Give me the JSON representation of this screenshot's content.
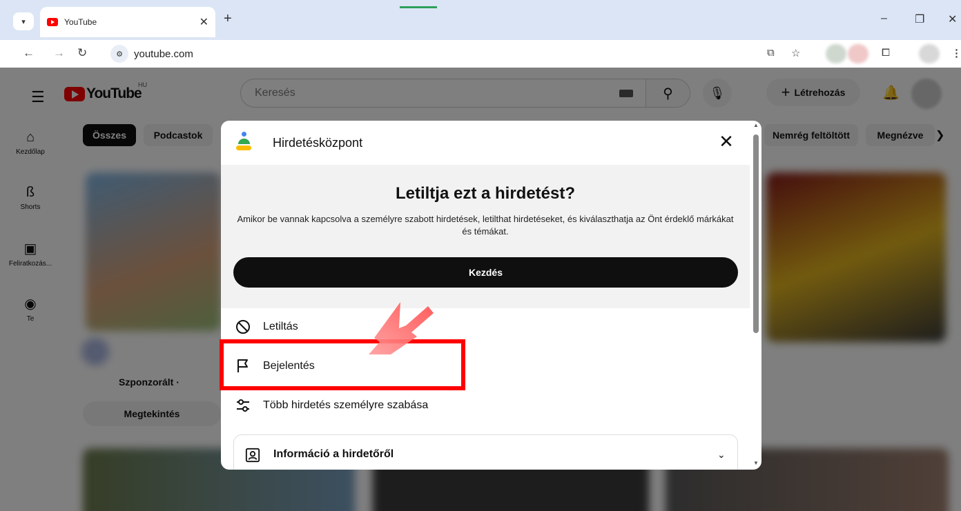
{
  "browser": {
    "tab_title": "YouTube",
    "url": "youtube.com",
    "icons": [
      "tab-search-icon",
      "close-icon",
      "new-tab-icon",
      "minimize-icon",
      "restore-icon",
      "close-window-icon",
      "back-icon",
      "forward-icon",
      "reload-icon",
      "site-info-icon",
      "cast-icon",
      "bookmark-star-icon",
      "extensions-icon",
      "kebab-menu-icon"
    ]
  },
  "youtube": {
    "logo_text": "YouTube",
    "country_code": "HU",
    "search_placeholder": "Keresés",
    "create_label": "Létrehozás",
    "sidebar": [
      {
        "label": "Kezdőlap",
        "icon": "home-icon"
      },
      {
        "label": "Shorts",
        "icon": "shorts-icon"
      },
      {
        "label": "Feliratkozás...",
        "icon": "subscriptions-icon"
      },
      {
        "label": "Te",
        "icon": "you-icon"
      }
    ],
    "chips": [
      {
        "label": "Összes",
        "active": true
      },
      {
        "label": "Podcastok",
        "active": false
      },
      {
        "label": "Nemrég feltöltött",
        "active": false
      },
      {
        "label": "Megnézve",
        "active": false
      }
    ],
    "sponsored_label": "Szponzorált ·",
    "watch_button": "Megtekintés"
  },
  "modal": {
    "title": "Hirdetésközpont",
    "heading": "Letiltja ezt a hirdetést?",
    "description": "Amikor be vannak kapcsolva a személyre szabott hirdetések, letilthat hirdetéseket, és kiválaszthatja az Önt érdeklő márkákat és témákat.",
    "start_button": "Kezdés",
    "options": [
      {
        "label": "Letiltás",
        "icon": "block-icon"
      },
      {
        "label": "Bejelentés",
        "icon": "flag-icon"
      },
      {
        "label": "Több hirdetés személyre szabása",
        "icon": "tune-icon"
      }
    ],
    "info_label": "Információ a hirdetőről"
  },
  "colors": {
    "highlight": "#ff0000",
    "arrow": "#ff5a5a",
    "youtube_red": "#ff0000",
    "tabbar_bg": "#dbe5f5"
  }
}
